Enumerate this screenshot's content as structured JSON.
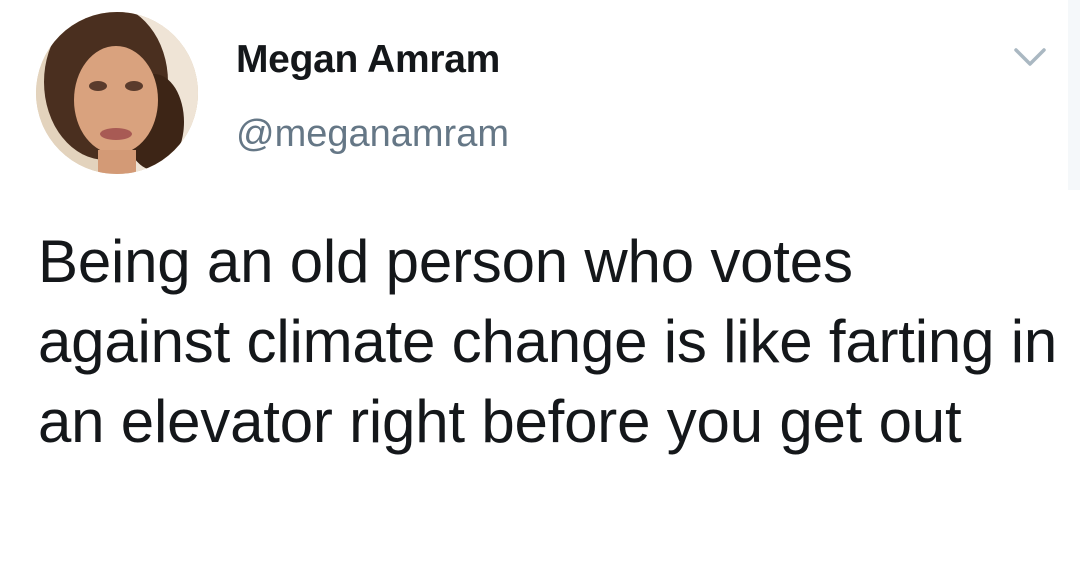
{
  "tweet": {
    "author": {
      "name": "Megan Amram",
      "handle": "@meganamram",
      "avatar_icon": "profile-photo"
    },
    "menu_icon": "chevron-down-icon",
    "text": "Being an old person who votes against climate change is like farting in an elevator right before you get out"
  },
  "colors": {
    "name": "#14171a",
    "handle": "#657786",
    "text": "#14171a",
    "caret": "#aab8c2",
    "background": "#ffffff"
  }
}
